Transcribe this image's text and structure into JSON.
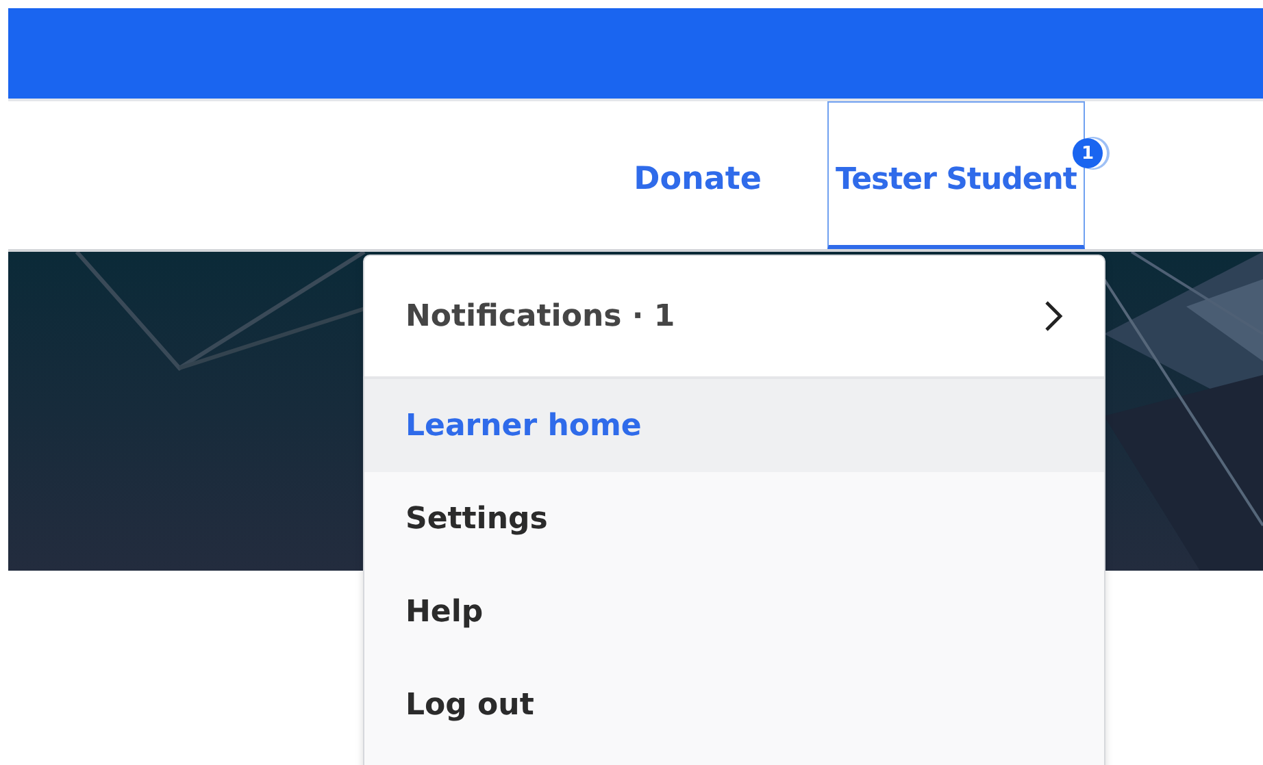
{
  "header": {
    "links": [
      {
        "label": "Donate"
      }
    ],
    "user": {
      "name": "Tester Student",
      "badge": "1",
      "expanded": true
    }
  },
  "menu": {
    "notifications": {
      "label": "Notifications · 1"
    },
    "items": [
      {
        "label": "Learner home",
        "selected": true
      },
      {
        "label": "Settings",
        "selected": false
      },
      {
        "label": "Help",
        "selected": false
      },
      {
        "label": "Log out",
        "selected": false
      }
    ]
  }
}
